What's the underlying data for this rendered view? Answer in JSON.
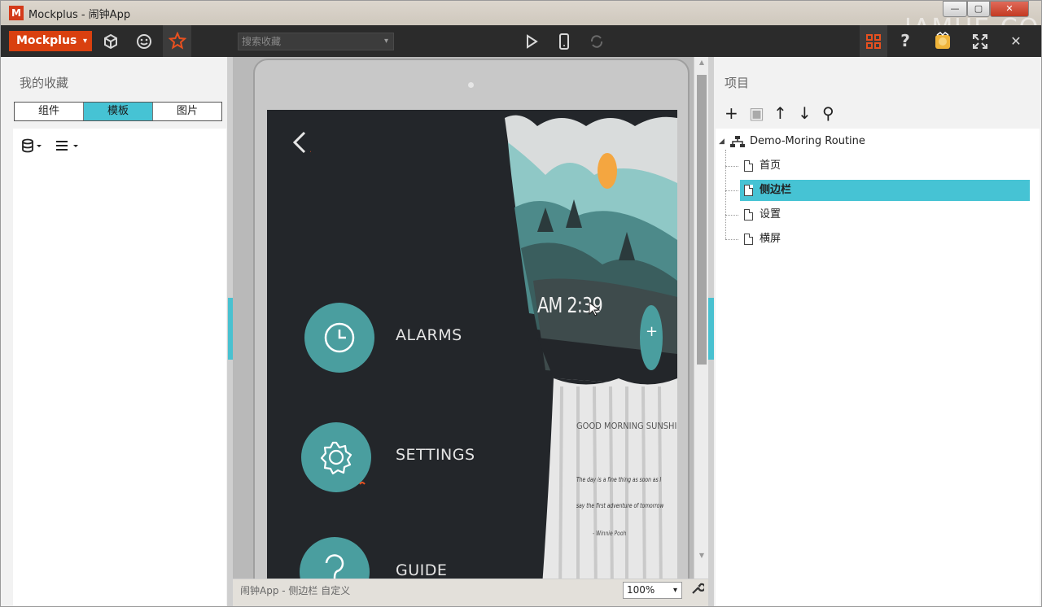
{
  "window": {
    "title": "Mockplus - 闹钟App",
    "app_icon": "M",
    "watermark": "IAMUE.COM",
    "controls": {
      "minimize": "—",
      "maximize": "▢",
      "close": "✕"
    }
  },
  "toolbar": {
    "brand_label": "Mockplus",
    "brand_caret": "▾",
    "search_placeholder": "搜索收藏",
    "search_caret": "▾",
    "icons": [
      "cube-icon",
      "emoji-icon",
      "star-icon",
      "play-icon",
      "phone-icon",
      "rotate-icon",
      "grid-icon",
      "help-icon",
      "user-badge-icon",
      "fullscreen-icon",
      "close-icon"
    ],
    "help_glyph": "?",
    "close_glyph": "✕",
    "accent": "#d9400f"
  },
  "left_panel": {
    "title": "我的收藏",
    "tabs": [
      {
        "label": "组件",
        "active": false
      },
      {
        "label": "模板",
        "active": true
      },
      {
        "label": "图片",
        "active": false
      }
    ],
    "tool_icons": [
      "database-icon",
      "list-icon"
    ]
  },
  "screen": {
    "menu": [
      {
        "label": "ALARMS",
        "icon": "clock-icon"
      },
      {
        "label": "SETTINGS",
        "icon": "gear-icon"
      },
      {
        "label": "GUIDE",
        "icon": "question-icon"
      }
    ],
    "curtain": {
      "time": "AM 2:39",
      "greeting": "GOOD MORNING SUNSHINE",
      "quote_line1": "The day is a fine thing as soon as I",
      "quote_line2": "say the first adventure of tomorrow",
      "quote_author": "- Winnie Pooh",
      "add_glyph": "+"
    },
    "colors": {
      "bg": "#23262a",
      "teal": "#4a9e9f",
      "sun": "#f4a640"
    }
  },
  "statusbar": {
    "breadcrumb": "闹钟App - 侧边栏 自定义",
    "zoom": "100%",
    "zoom_caret": "▾"
  },
  "right_panel": {
    "title": "项目",
    "tool_icons": [
      "add-icon",
      "save-icon",
      "move-up-icon",
      "move-down-icon",
      "search-icon"
    ],
    "tool_glyphs": [
      "+",
      "▣",
      "↑",
      "↓",
      "⚲"
    ],
    "project_name": "Demo-Moring Routine",
    "pages": [
      {
        "label": "首页",
        "selected": false
      },
      {
        "label": "侧边栏",
        "selected": true
      },
      {
        "label": "设置",
        "selected": false
      },
      {
        "label": "横屏",
        "selected": false
      }
    ],
    "selection_color": "#46c3d4"
  }
}
